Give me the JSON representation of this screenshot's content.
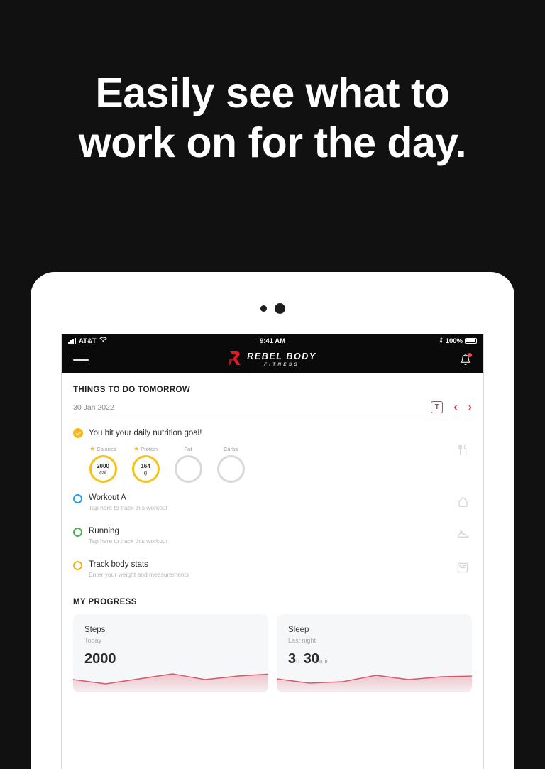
{
  "promo": {
    "headline_line1": "Easily see what to",
    "headline_line2": "work on for the day.",
    "background": "#111111"
  },
  "device": {
    "status_bar": {
      "carrier": "AT&T",
      "time": "9:41 AM",
      "battery_percent": "100%",
      "signal_icon": "signal-bars-icon",
      "wifi_icon": "wifi-icon",
      "bluetooth_icon": "bluetooth-icon",
      "battery_icon": "battery-full-icon"
    }
  },
  "appbar": {
    "menu_icon": "hamburger-menu-icon",
    "brand_name": "REBEL BODY",
    "brand_sub": "FITNESS",
    "logo_icon": "rebel-r-logo-icon",
    "notifications_icon": "bell-icon",
    "has_notification": true,
    "background": "#0a0a0a",
    "logo_color": "#e01b24"
  },
  "todo": {
    "section_title": "THINGS TO DO TOMORROW",
    "date": "30 Jan 2022",
    "today_button": "T",
    "prev_icon": "chevron-left-icon",
    "next_icon": "chevron-right-icon",
    "accent": "#e8333f"
  },
  "nutrition": {
    "title": "You hit your daily nutrition goal!",
    "completed": true,
    "row_icon": "cutlery-icon",
    "rings": [
      {
        "label": "Calories",
        "starred": true,
        "value": "2000",
        "unit": "cal",
        "filled": true
      },
      {
        "label": "Protein",
        "starred": true,
        "value": "164",
        "unit": "g",
        "filled": true
      },
      {
        "label": "Fat",
        "starred": false,
        "value": "",
        "unit": "",
        "filled": false
      },
      {
        "label": "Carbs",
        "starred": false,
        "value": "",
        "unit": "",
        "filled": false
      }
    ],
    "filled_color": "#f9c116",
    "empty_color": "#d8d8d8"
  },
  "tasks": [
    {
      "title": "Workout A",
      "subtitle": "Tap here to track this workout",
      "ring_color": "#1e9ff2",
      "icon": "kettlebell-icon"
    },
    {
      "title": "Running",
      "subtitle": "Tap here to track this workout",
      "ring_color": "#4caf50",
      "icon": "running-shoe-icon"
    },
    {
      "title": "Track body stats",
      "subtitle": "Enter your weight and measurements",
      "ring_color": "#f3b01c",
      "icon": "weight-scale-icon"
    }
  ],
  "progress": {
    "section_title": "MY PROGRESS",
    "cards": [
      {
        "title": "Steps",
        "subtitle": "Today",
        "value": "2000",
        "unit": "",
        "value2": "",
        "unit2": ""
      },
      {
        "title": "Sleep",
        "subtitle": "Last night",
        "value": "3",
        "unit": "h",
        "value2": "30",
        "unit2": "min"
      }
    ],
    "spark_color": "#e0697a"
  },
  "chart_data": [
    {
      "type": "area",
      "title": "Steps",
      "x": [
        0,
        1,
        2,
        3,
        4,
        5,
        6
      ],
      "values": [
        12,
        6,
        14,
        19,
        13,
        16,
        18
      ],
      "ylim": [
        0,
        30
      ],
      "xlabel": "",
      "ylabel": "",
      "legend": "none",
      "grid": false
    },
    {
      "type": "area",
      "title": "Sleep",
      "x": [
        0,
        1,
        2,
        3,
        4,
        5,
        6
      ],
      "values": [
        13,
        7,
        9,
        17,
        12,
        15,
        16
      ],
      "ylim": [
        0,
        30
      ],
      "xlabel": "",
      "ylabel": "",
      "legend": "none",
      "grid": false
    }
  ]
}
